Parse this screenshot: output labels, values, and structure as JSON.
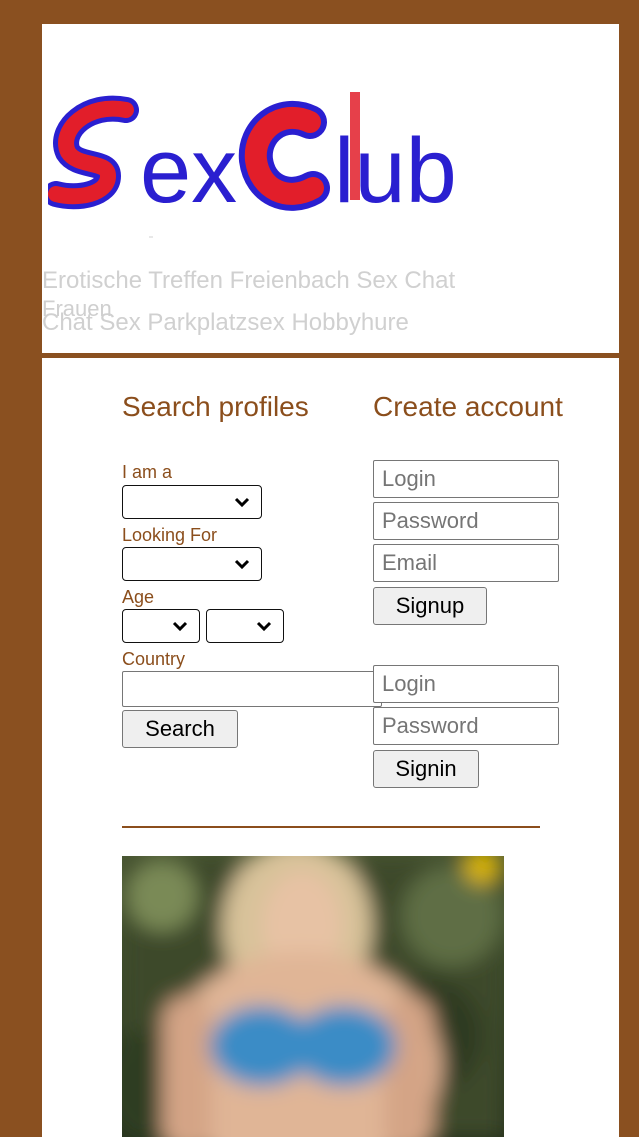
{
  "header": {
    "logo_text": "SexClub",
    "tagline_line1": "Erotische Treffen Freienbach Sex Chat",
    "tagline_line2": "Chat Sex Parkplatzsex Hobbyhure",
    "tagline_overlap": "Frauen"
  },
  "search": {
    "title": "Search profiles",
    "i_am_label": "I am a",
    "looking_for_label": "Looking For",
    "age_label": "Age",
    "country_label": "Country",
    "search_button": "Search"
  },
  "create_account": {
    "title": "Create account",
    "login_placeholder": "Login",
    "password_placeholder": "Password",
    "email_placeholder": "Email",
    "signup_button": "Signup"
  },
  "signin": {
    "login_placeholder": "Login",
    "password_placeholder": "Password",
    "signin_button": "Signin"
  },
  "colors": {
    "frame": "#8a5020",
    "accent_text": "#8b4e1c",
    "logo_red": "#e21e2a",
    "logo_blue": "#2a1fd0"
  }
}
